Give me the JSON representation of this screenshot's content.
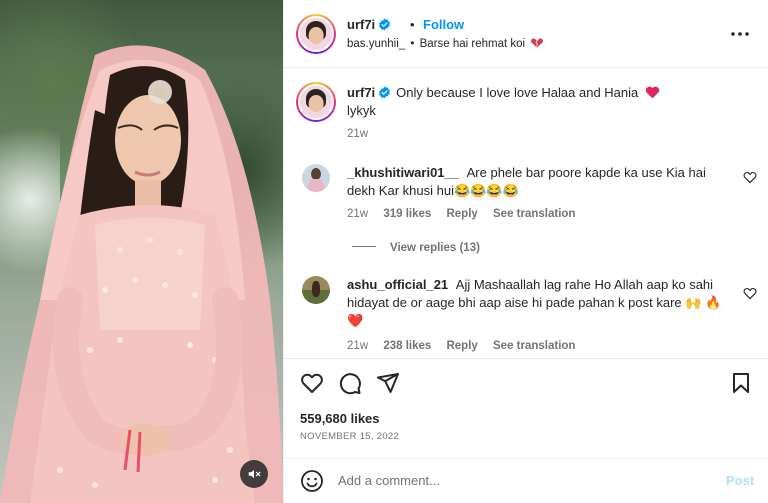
{
  "header": {
    "username": "urf7i",
    "separator": "•",
    "follow_label": "Follow",
    "sub_left": "bas.yunhii_",
    "sub_sep": "•",
    "sub_right": "Barse hai rehmat koi"
  },
  "caption": {
    "username": "urf7i",
    "text": "Only because I love love Halaa and Hania",
    "line2": "lykyk",
    "time": "21w"
  },
  "comments": [
    {
      "username": "_khushitiwari01__",
      "text": "Are phele bar poore kapde ka use Kia hai dekh Kar khusi hui😂😂😂😂",
      "time": "21w",
      "likes": "319 likes",
      "reply": "Reply",
      "translate": "See translation",
      "view_replies": "View replies (13)"
    },
    {
      "username": "ashu_official_21",
      "text": "Ajj Mashaallah lag rahe Ho Allah aap ko sahi hidayat de or aage bhi aap aise hi pade pahan k post kare 🙌 🔥❤️",
      "time": "21w",
      "likes": "238 likes",
      "reply": "Reply",
      "translate": "See translation"
    }
  ],
  "stats": {
    "likes": "559,680 likes",
    "date": "NOVEMBER 15, 2022"
  },
  "composer": {
    "placeholder": "Add a comment...",
    "post_label": "Post"
  },
  "icons": {
    "verified": "verified-badge-icon",
    "more": "more-options-icon",
    "like": "heart-icon",
    "comment": "comment-icon",
    "share": "share-icon",
    "save": "bookmark-icon",
    "emoji": "emoji-icon",
    "mute": "audio-muted-icon"
  },
  "colors": {
    "accent": "#0095f6",
    "post_disabled": "#b2dffc",
    "muted_text": "#737373",
    "heart": "#ed4956"
  }
}
